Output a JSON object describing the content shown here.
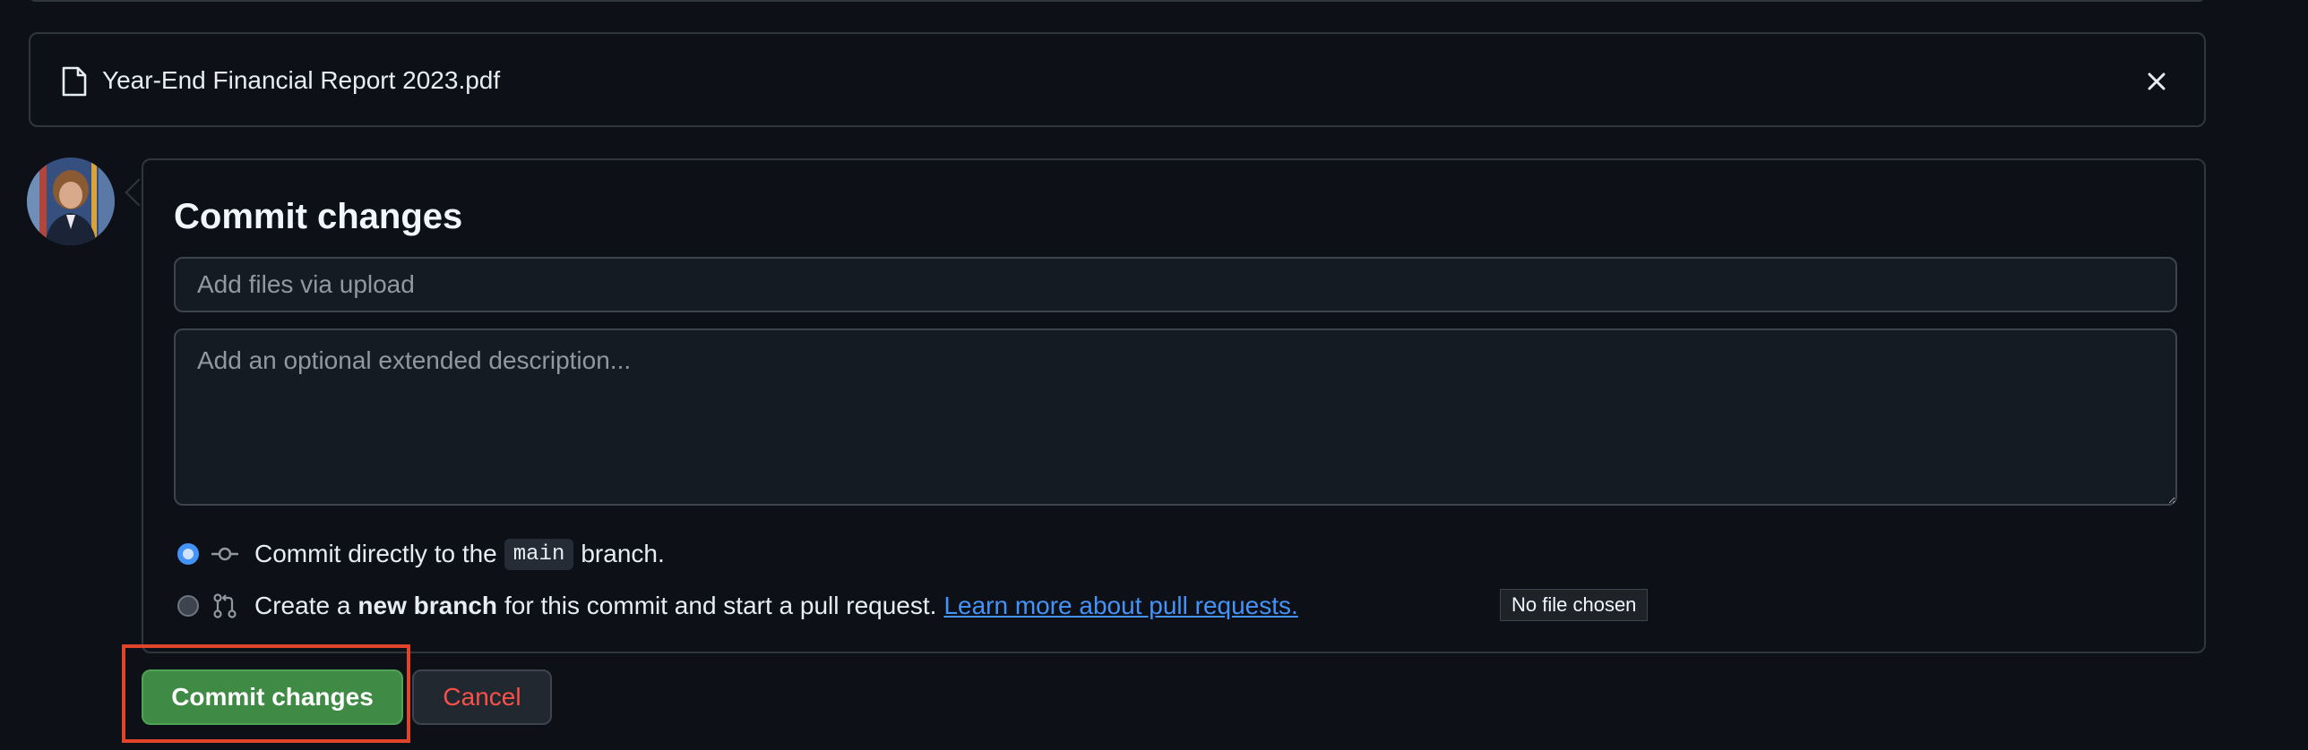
{
  "file": {
    "name": "Year-End Financial Report 2023.pdf",
    "icon": "file-icon",
    "close_icon": "close-icon"
  },
  "commit": {
    "title": "Commit changes",
    "summary_placeholder": "Add files via upload",
    "summary_value": "",
    "description_placeholder": "Add an optional extended description...",
    "description_value": "",
    "option_direct": {
      "prefix": "Commit directly to the",
      "branch": "main",
      "suffix": "branch.",
      "selected": true
    },
    "option_new_branch": {
      "prefix": "Create a",
      "bold": "new branch",
      "suffix": "for this commit and start a pull request.",
      "link": "Learn more about pull requests.",
      "selected": false
    },
    "file_input_status": "No file chosen"
  },
  "buttons": {
    "commit_label": "Commit changes",
    "cancel_label": "Cancel"
  },
  "colors": {
    "background": "#0d1117",
    "primary_button": "#3f8a44",
    "danger_text": "#f85149",
    "link": "#4493f8",
    "highlight": "#e0452b"
  }
}
